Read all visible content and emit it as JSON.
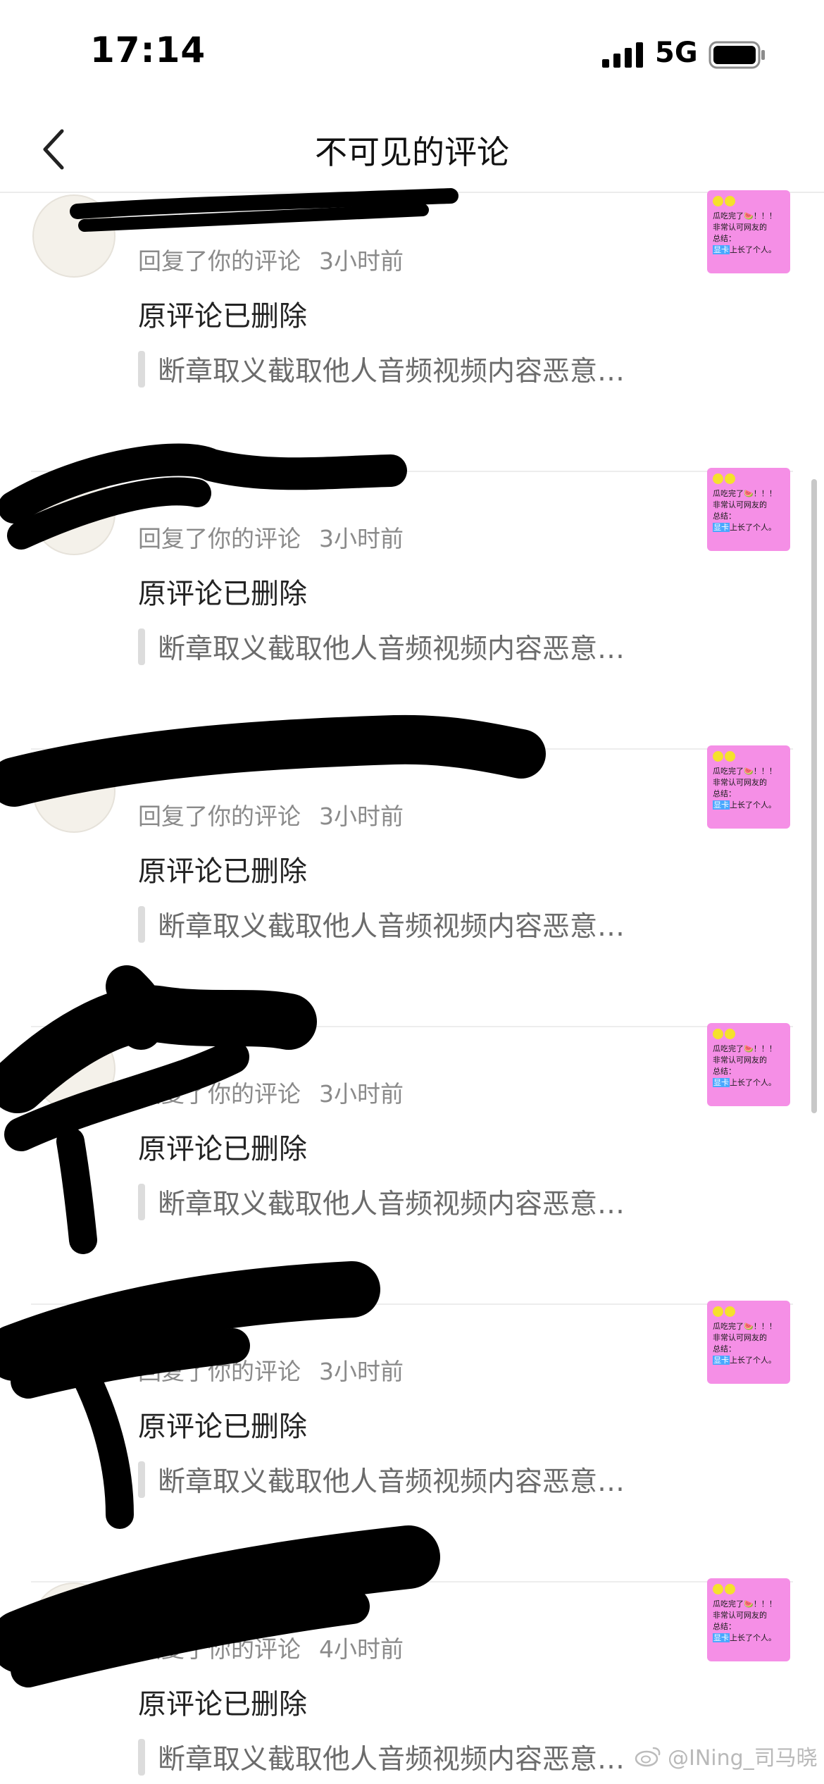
{
  "status_bar": {
    "time": "17:14",
    "network": "5G",
    "icons": [
      "signal-icon",
      "battery-icon"
    ]
  },
  "nav": {
    "title": "不可见的评论",
    "back_icon": "chevron-left-icon"
  },
  "comments": [
    {
      "username": "",
      "action": "回复了你的评论",
      "time": "3小时前",
      "body": "原评论已删除",
      "quote": "断章取义截取他人音频视频内容恶意…"
    },
    {
      "username": "",
      "action": "回复了你的评论",
      "time": "3小时前",
      "body": "原评论已删除",
      "quote": "断章取义截取他人音频视频内容恶意…"
    },
    {
      "username": "",
      "action": "回复了你的评论",
      "time": "3小时前",
      "body": "原评论已删除",
      "quote": "断章取义截取他人音频视频内容恶意…"
    },
    {
      "username": "",
      "action": "回复了你的评论",
      "time": "3小时前",
      "body": "原评论已删除",
      "quote": "断章取义截取他人音频视频内容恶意…"
    },
    {
      "username": "",
      "action": "回复了你的评论",
      "time": "3小时前",
      "body": "原评论已删除",
      "quote": "断章取义截取他人音频视频内容恶意…"
    },
    {
      "username": "",
      "action": "回复了你的评论",
      "time": "4小时前",
      "body": "原评论已删除",
      "quote": "断章取义截取他人音频视频内容恶意…"
    }
  ],
  "thumbnail": {
    "lines": [
      "瓜吃完了🍉！！！",
      "非常认可网友的",
      "总结：",
      "上长了个人。"
    ],
    "highlight": "显卡",
    "background": "#f58fe6"
  },
  "watermark": {
    "text": "@INing_司马晓",
    "icon": "weibo-icon"
  }
}
